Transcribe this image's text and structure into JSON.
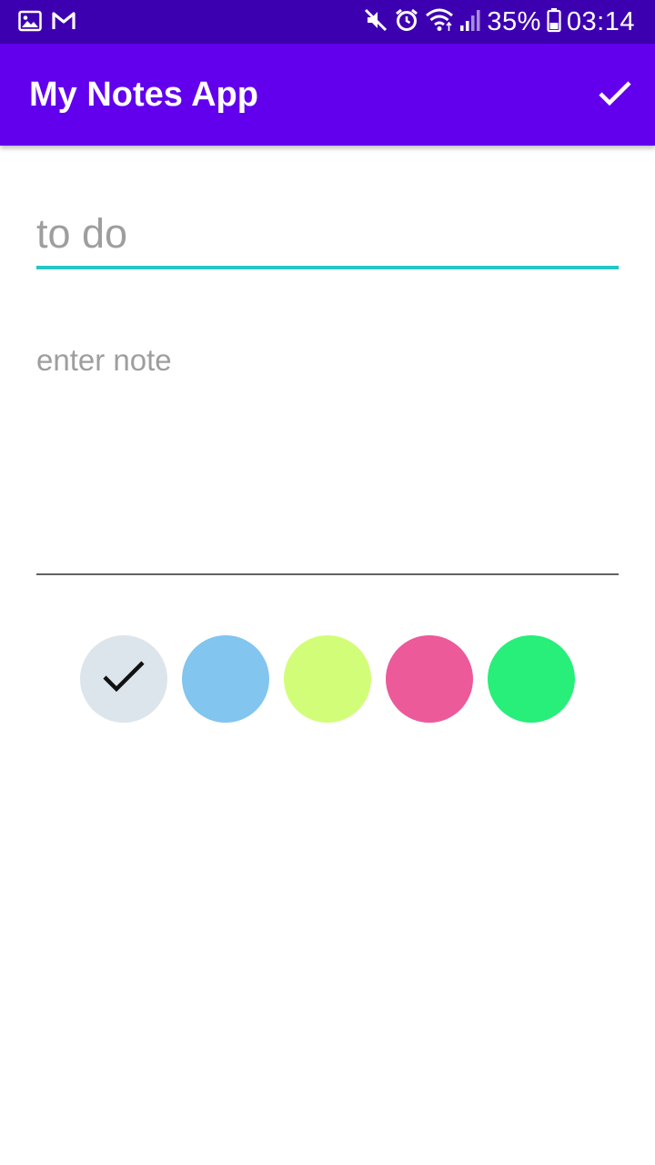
{
  "status_bar": {
    "battery": "35%",
    "time": "03:14",
    "icons": [
      "image-icon",
      "gmail-icon",
      "mute-icon",
      "alarm-icon",
      "wifi-icon",
      "signal-icon",
      "battery-icon"
    ]
  },
  "app_bar": {
    "title": "My Notes App",
    "confirm_icon": "check-icon"
  },
  "form": {
    "title_placeholder": "to do",
    "title_value": "",
    "note_placeholder": "enter note",
    "note_value": ""
  },
  "colors": [
    {
      "name": "grey",
      "hex": "#dde5ec",
      "selected": true
    },
    {
      "name": "blue",
      "hex": "#82c5ee",
      "selected": false
    },
    {
      "name": "lime",
      "hex": "#d2fd79",
      "selected": false
    },
    {
      "name": "pink",
      "hex": "#ec5a9a",
      "selected": false
    },
    {
      "name": "green",
      "hex": "#28ee7a",
      "selected": false
    }
  ],
  "theme": {
    "status_bar": "#3d00b0",
    "app_bar": "#6200ee",
    "accent": "#26c6c6"
  }
}
